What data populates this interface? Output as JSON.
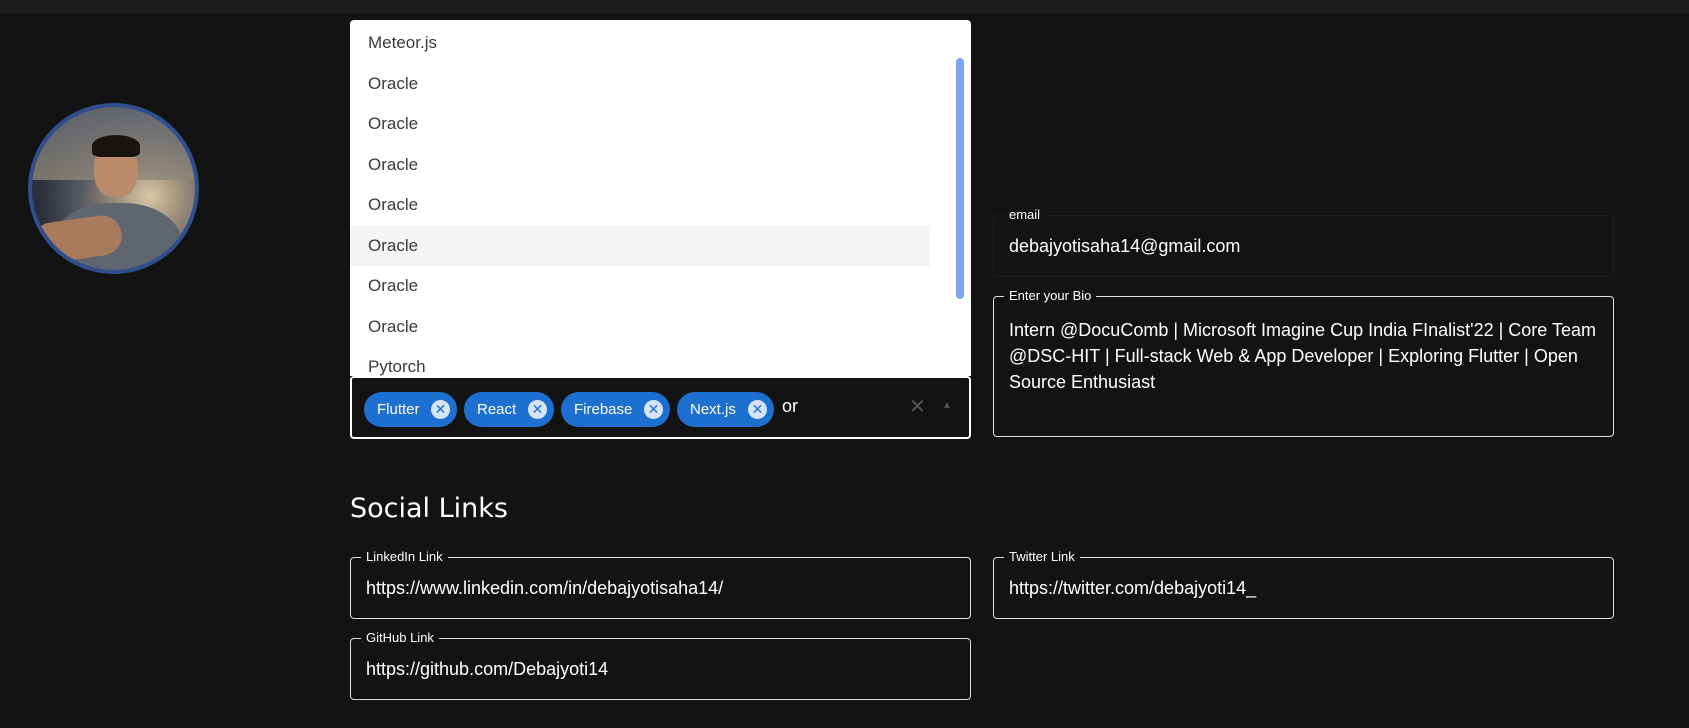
{
  "dropdown": {
    "options": [
      "Meteor.js",
      "Oracle",
      "Oracle",
      "Oracle",
      "Oracle",
      "Oracle",
      "Oracle",
      "Oracle",
      "Pytorch"
    ]
  },
  "skills": {
    "chips": [
      "Flutter",
      "React",
      "Firebase",
      "Next.js"
    ],
    "input_value": "or",
    "remove_glyph": "✕",
    "clear_glyph": "✕",
    "toggle_glyph": "▲"
  },
  "profile": {
    "email_label": "email",
    "email_value": "debajyotisaha14@gmail.com",
    "bio_label": "Enter your Bio",
    "bio_value": "Intern @DocuComb | Microsoft Imagine Cup India FInalist'22 | Core Team @DSC-HIT | Full-stack Web & App Developer | Exploring Flutter | Open Source Enthusiast"
  },
  "social": {
    "title": "Social Links",
    "linkedin_label": "LinkedIn Link",
    "linkedin_value": "https://www.linkedin.com/in/debajyotisaha14/",
    "twitter_label": "Twitter Link",
    "twitter_value": "https://twitter.com/debajyoti14_",
    "github_label": "GitHub Link",
    "github_value": "https://github.com/Debajyoti14"
  },
  "colors": {
    "background": "#131313",
    "chip": "#1d6fd0",
    "avatar_border": "#2f4f8f",
    "scrollbar": "#7ea3ef"
  }
}
